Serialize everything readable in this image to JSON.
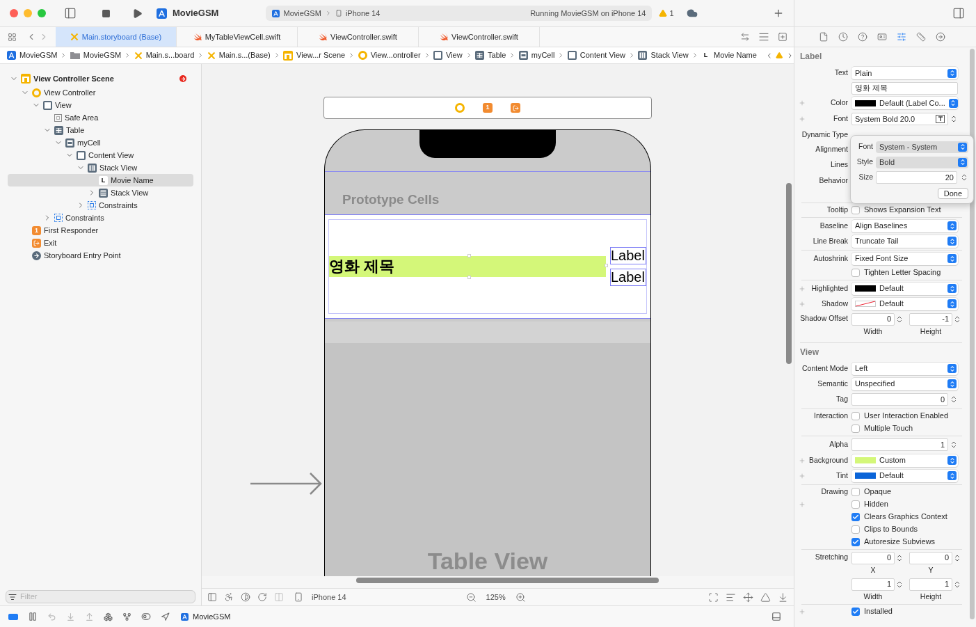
{
  "toolbar": {
    "scheme": "MovieGSM",
    "run_target": "MovieGSM",
    "device": "iPhone 14",
    "status": "Running MovieGSM on iPhone 14",
    "warnings": "1"
  },
  "tabs": [
    {
      "label": "Main.storyboard (Base)",
      "kind": "storyboard",
      "selected": true
    },
    {
      "label": "MyTableViewCell.swift",
      "kind": "swift",
      "selected": false
    },
    {
      "label": "ViewController.swift",
      "kind": "swift",
      "selected": false
    },
    {
      "label": "ViewController.swift",
      "kind": "swift",
      "selected": false
    }
  ],
  "jump_bar": [
    {
      "label": "MovieGSM",
      "kind": "app"
    },
    {
      "label": "MovieGSM",
      "kind": "folder"
    },
    {
      "label": "Main.s...board",
      "kind": "storyboard"
    },
    {
      "label": "Main.s...(Base)",
      "kind": "storyboard"
    },
    {
      "label": "View...r Scene",
      "kind": "scene"
    },
    {
      "label": "View...ontroller",
      "kind": "vc"
    },
    {
      "label": "View",
      "kind": "view"
    },
    {
      "label": "Table",
      "kind": "table"
    },
    {
      "label": "myCell",
      "kind": "cell"
    },
    {
      "label": "Content View",
      "kind": "view"
    },
    {
      "label": "Stack View",
      "kind": "stack_h"
    },
    {
      "label": "Movie Name",
      "kind": "label",
      "glyph": "L"
    }
  ],
  "navigator": {
    "filter_placeholder": "Filter",
    "tree": [
      {
        "label": "View Controller Scene",
        "kind": "scene",
        "expanded": true,
        "selected": false,
        "children": [
          {
            "label": "View Controller",
            "kind": "vc",
            "expanded": true,
            "selected": false,
            "children": [
              {
                "label": "View",
                "kind": "view",
                "expanded": true,
                "selected": false,
                "children": [
                  {
                    "label": "Safe Area",
                    "kind": "safearea",
                    "selected": false
                  },
                  {
                    "label": "Table",
                    "kind": "table",
                    "expanded": true,
                    "selected": false,
                    "children": [
                      {
                        "label": "myCell",
                        "kind": "cell",
                        "expanded": true,
                        "selected": false,
                        "children": [
                          {
                            "label": "Content View",
                            "kind": "view",
                            "expanded": true,
                            "selected": false,
                            "children": [
                              {
                                "label": "Stack View",
                                "kind": "stack_h",
                                "expanded": true,
                                "selected": false,
                                "children": [
                                  {
                                    "label": "Movie Name",
                                    "kind": "label",
                                    "glyph": "L",
                                    "selected": true
                                  },
                                  {
                                    "label": "Stack View",
                                    "kind": "stack_v",
                                    "expanded": false,
                                    "selected": false
                                  }
                                ]
                              },
                              {
                                "label": "Constraints",
                                "kind": "constraints",
                                "expanded": false,
                                "selected": false
                              }
                            ]
                          }
                        ]
                      }
                    ]
                  },
                  {
                    "label": "Constraints",
                    "kind": "constraints",
                    "expanded": false,
                    "selected": false
                  }
                ]
              }
            ]
          },
          {
            "label": "First Responder",
            "kind": "responder",
            "glyph": "1",
            "selected": false
          },
          {
            "label": "Exit",
            "kind": "exit",
            "selected": false
          },
          {
            "label": "Storyboard Entry Point",
            "kind": "entry",
            "selected": false
          }
        ]
      }
    ]
  },
  "canvas": {
    "dock": [
      {
        "kind": "vc"
      },
      {
        "kind": "responder",
        "glyph": "1"
      },
      {
        "kind": "exit"
      }
    ],
    "section_header": "Prototype Cells",
    "cell_title": {
      "text": "영화 제목",
      "color": "#d4f779"
    },
    "cell_labels": [
      "Label",
      "Label"
    ],
    "table_caption": "Table View",
    "device": "iPhone 14",
    "zoom": "125%"
  },
  "debug_bar": {
    "target": "MovieGSM"
  },
  "inspector": {
    "sections": [
      {
        "title": "Label",
        "groups": [
          [
            {
              "kind": "popup",
              "label": "Text",
              "value": "Plain"
            },
            {
              "kind": "text",
              "value": "영화 제목"
            },
            {
              "kind": "popup",
              "label": "Color",
              "value": "Default (Label Co...",
              "color": "#000000",
              "plus": true
            },
            {
              "kind": "font",
              "label": "Font",
              "value": "System Bold 20.0",
              "plus": true
            },
            {
              "kind": "covered",
              "label": "Dynamic Type"
            },
            {
              "kind": "covered",
              "label": "Alignment"
            },
            {
              "kind": "covered",
              "label": "Lines"
            },
            {
              "kind": "covered",
              "label": "Behavior"
            }
          ],
          [
            {
              "kind": "checkbox",
              "label": "Tooltip",
              "value": "Shows Expansion Text",
              "checked": false
            }
          ],
          [
            {
              "kind": "popup",
              "label": "Baseline",
              "value": "Align Baselines"
            },
            {
              "kind": "popup",
              "label": "Line Break",
              "value": "Truncate Tail"
            }
          ],
          [
            {
              "kind": "popup",
              "label": "Autoshrink",
              "value": "Fixed Font Size"
            },
            {
              "kind": "checkbox",
              "value": "Tighten Letter Spacing",
              "checked": false
            }
          ],
          [
            {
              "kind": "popup",
              "label": "Highlighted",
              "value": "Default",
              "color": "#000000",
              "plus": true
            },
            {
              "kind": "popup",
              "label": "Shadow",
              "value": "Default",
              "no_color": true,
              "plus": true
            },
            {
              "kind": "pair",
              "label": "Shadow Offset",
              "fields": [
                {
                  "value": "0",
                  "caption": "Width"
                },
                {
                  "value": "-1",
                  "caption": "Height"
                }
              ]
            }
          ]
        ]
      },
      {
        "title": "View",
        "groups": [
          [
            {
              "kind": "popup",
              "label": "Content Mode",
              "value": "Left"
            },
            {
              "kind": "popup",
              "label": "Semantic",
              "value": "Unspecified"
            },
            {
              "kind": "stepper",
              "label": "Tag",
              "value": "0"
            }
          ],
          [
            {
              "kind": "checkbox",
              "label": "Interaction",
              "value": "User Interaction Enabled",
              "checked": false
            },
            {
              "kind": "checkbox",
              "value": "Multiple Touch",
              "checked": false
            }
          ],
          [
            {
              "kind": "stepper",
              "label": "Alpha",
              "value": "1"
            },
            {
              "kind": "popup",
              "label": "Background",
              "value": "Custom",
              "color": "#d4f779",
              "plus": true
            },
            {
              "kind": "popup",
              "label": "Tint",
              "value": "Default",
              "color": "#0a64d8",
              "plus": true
            }
          ],
          [
            {
              "kind": "checkbox",
              "label": "Drawing",
              "value": "Opaque",
              "checked": false
            },
            {
              "kind": "checkbox",
              "value": "Hidden",
              "checked": false,
              "plus": true
            },
            {
              "kind": "checkbox",
              "value": "Clears Graphics Context",
              "checked": true
            },
            {
              "kind": "checkbox",
              "value": "Clips to Bounds",
              "checked": false
            },
            {
              "kind": "checkbox",
              "value": "Autoresize Subviews",
              "checked": true
            }
          ],
          [
            {
              "kind": "pair",
              "label": "Stretching",
              "fields": [
                {
                  "value": "0",
                  "caption": "X"
                },
                {
                  "value": "0",
                  "caption": "Y"
                }
              ]
            },
            {
              "kind": "pair",
              "fields": [
                {
                  "value": "1",
                  "caption": "Width"
                },
                {
                  "value": "1",
                  "caption": "Height"
                }
              ]
            }
          ],
          [
            {
              "kind": "checkbox",
              "value": "Installed",
              "checked": true,
              "plus": true
            }
          ]
        ]
      }
    ],
    "popover": {
      "rows": [
        {
          "kind": "popup",
          "label": "Font",
          "value": "System - System"
        },
        {
          "kind": "popup",
          "label": "Style",
          "value": "Bold"
        },
        {
          "kind": "stepper",
          "label": "Size",
          "value": "20"
        }
      ],
      "button": "Done"
    }
  }
}
